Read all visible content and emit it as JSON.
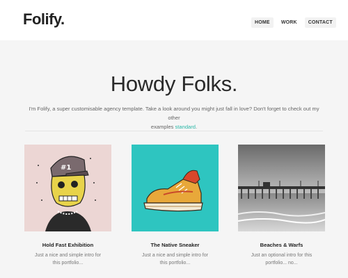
{
  "header": {
    "logo": "Folify.",
    "nav": [
      "HOME",
      "WORK",
      "CONTACT"
    ]
  },
  "hero": {
    "title": "Howdy Folks.",
    "intro_line1": "I'm Folify, a super customisable agency template. Take a look around you might just fall in love? Don't forget to check out my other",
    "intro_prefix": "examples",
    "intro_link": "standard",
    "intro_suffix": "."
  },
  "portfolio": [
    {
      "title": "Hold Fast Exhibition",
      "desc": "Just a nice and simple intro for this portfolio...",
      "icon": "cartoon-skull-illustration"
    },
    {
      "title": "The Native Sneaker",
      "desc": "Just a nice and simple intro for this portfolio...",
      "icon": "sneaker-illustration"
    },
    {
      "title": "Beaches & Warfs",
      "desc": "Just an optional intro for this portfolio... no...",
      "icon": "pier-photo"
    }
  ],
  "colors": {
    "accent": "#2bb8a8",
    "background": "#f5f5f5",
    "header": "#ffffff"
  }
}
